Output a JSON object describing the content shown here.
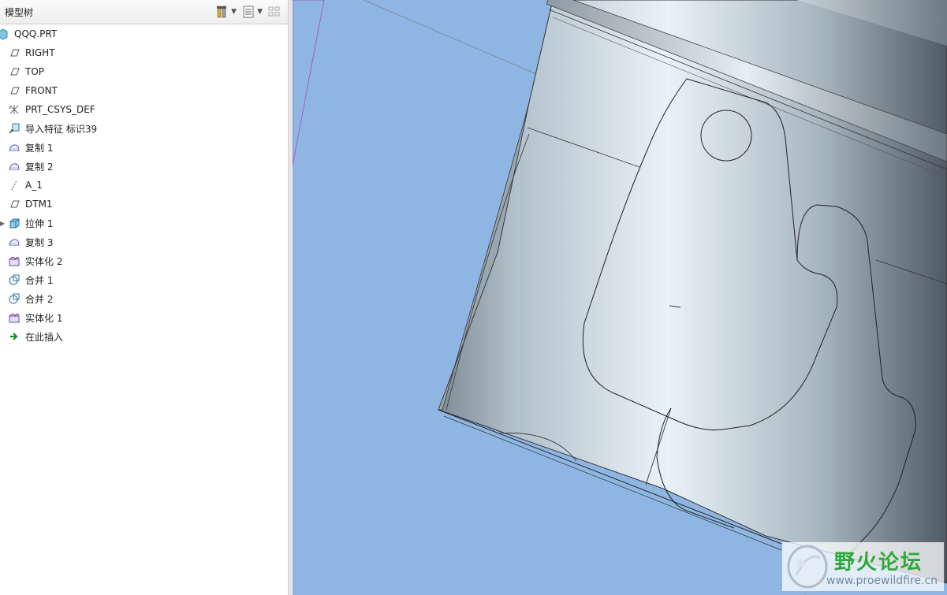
{
  "panel": {
    "title": "模型树"
  },
  "tree": [
    {
      "label": "QQQ.PRT",
      "icon": "part-icon"
    },
    {
      "label": "RIGHT",
      "icon": "datum-plane-icon"
    },
    {
      "label": "TOP",
      "icon": "datum-plane-icon"
    },
    {
      "label": "FRONT",
      "icon": "datum-plane-icon"
    },
    {
      "label": "PRT_CSYS_DEF",
      "icon": "coordinate-system-icon"
    },
    {
      "label": "导入特征 标识39",
      "icon": "import-feature-icon"
    },
    {
      "label": "复制 1",
      "icon": "copy-surface-icon"
    },
    {
      "label": "复制 2",
      "icon": "copy-surface-icon"
    },
    {
      "label": "A_1",
      "icon": "datum-axis-icon"
    },
    {
      "label": "DTM1",
      "icon": "datum-plane-icon"
    },
    {
      "label": "拉伸 1",
      "icon": "extrude-icon"
    },
    {
      "label": "复制 3",
      "icon": "copy-surface-icon"
    },
    {
      "label": "实体化 2",
      "icon": "solidify-icon"
    },
    {
      "label": "合并 1",
      "icon": "merge-icon"
    },
    {
      "label": "合并 2",
      "icon": "merge-icon"
    },
    {
      "label": "实体化 1",
      "icon": "solidify-icon"
    },
    {
      "label": "在此插入",
      "icon": "insert-here-arrow-icon"
    }
  ],
  "watermark": {
    "name": "野火论坛",
    "url": "www.proewildfire.cn"
  },
  "colors": {
    "viewport_bg": "#8fb6e2",
    "watermark_text": "#2fa83a"
  }
}
